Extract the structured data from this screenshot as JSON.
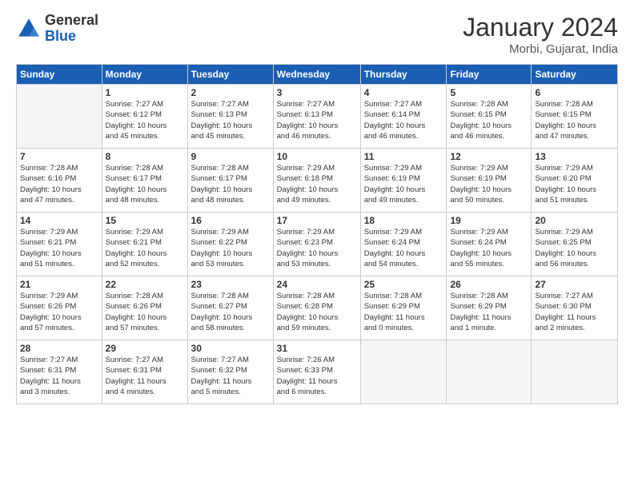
{
  "logo": {
    "general": "General",
    "blue": "Blue"
  },
  "header": {
    "month_year": "January 2024",
    "location": "Morbi, Gujarat, India"
  },
  "weekdays": [
    "Sunday",
    "Monday",
    "Tuesday",
    "Wednesday",
    "Thursday",
    "Friday",
    "Saturday"
  ],
  "weeks": [
    [
      {
        "day": "",
        "info": ""
      },
      {
        "day": "1",
        "info": "Sunrise: 7:27 AM\nSunset: 6:12 PM\nDaylight: 10 hours\nand 45 minutes."
      },
      {
        "day": "2",
        "info": "Sunrise: 7:27 AM\nSunset: 6:13 PM\nDaylight: 10 hours\nand 45 minutes."
      },
      {
        "day": "3",
        "info": "Sunrise: 7:27 AM\nSunset: 6:13 PM\nDaylight: 10 hours\nand 46 minutes."
      },
      {
        "day": "4",
        "info": "Sunrise: 7:27 AM\nSunset: 6:14 PM\nDaylight: 10 hours\nand 46 minutes."
      },
      {
        "day": "5",
        "info": "Sunrise: 7:28 AM\nSunset: 6:15 PM\nDaylight: 10 hours\nand 46 minutes."
      },
      {
        "day": "6",
        "info": "Sunrise: 7:28 AM\nSunset: 6:15 PM\nDaylight: 10 hours\nand 47 minutes."
      }
    ],
    [
      {
        "day": "7",
        "info": "Sunrise: 7:28 AM\nSunset: 6:16 PM\nDaylight: 10 hours\nand 47 minutes."
      },
      {
        "day": "8",
        "info": "Sunrise: 7:28 AM\nSunset: 6:17 PM\nDaylight: 10 hours\nand 48 minutes."
      },
      {
        "day": "9",
        "info": "Sunrise: 7:28 AM\nSunset: 6:17 PM\nDaylight: 10 hours\nand 48 minutes."
      },
      {
        "day": "10",
        "info": "Sunrise: 7:29 AM\nSunset: 6:18 PM\nDaylight: 10 hours\nand 49 minutes."
      },
      {
        "day": "11",
        "info": "Sunrise: 7:29 AM\nSunset: 6:19 PM\nDaylight: 10 hours\nand 49 minutes."
      },
      {
        "day": "12",
        "info": "Sunrise: 7:29 AM\nSunset: 6:19 PM\nDaylight: 10 hours\nand 50 minutes."
      },
      {
        "day": "13",
        "info": "Sunrise: 7:29 AM\nSunset: 6:20 PM\nDaylight: 10 hours\nand 51 minutes."
      }
    ],
    [
      {
        "day": "14",
        "info": "Sunrise: 7:29 AM\nSunset: 6:21 PM\nDaylight: 10 hours\nand 51 minutes."
      },
      {
        "day": "15",
        "info": "Sunrise: 7:29 AM\nSunset: 6:21 PM\nDaylight: 10 hours\nand 52 minutes."
      },
      {
        "day": "16",
        "info": "Sunrise: 7:29 AM\nSunset: 6:22 PM\nDaylight: 10 hours\nand 53 minutes."
      },
      {
        "day": "17",
        "info": "Sunrise: 7:29 AM\nSunset: 6:23 PM\nDaylight: 10 hours\nand 53 minutes."
      },
      {
        "day": "18",
        "info": "Sunrise: 7:29 AM\nSunset: 6:24 PM\nDaylight: 10 hours\nand 54 minutes."
      },
      {
        "day": "19",
        "info": "Sunrise: 7:29 AM\nSunset: 6:24 PM\nDaylight: 10 hours\nand 55 minutes."
      },
      {
        "day": "20",
        "info": "Sunrise: 7:29 AM\nSunset: 6:25 PM\nDaylight: 10 hours\nand 56 minutes."
      }
    ],
    [
      {
        "day": "21",
        "info": "Sunrise: 7:29 AM\nSunset: 6:26 PM\nDaylight: 10 hours\nand 57 minutes."
      },
      {
        "day": "22",
        "info": "Sunrise: 7:28 AM\nSunset: 6:26 PM\nDaylight: 10 hours\nand 57 minutes."
      },
      {
        "day": "23",
        "info": "Sunrise: 7:28 AM\nSunset: 6:27 PM\nDaylight: 10 hours\nand 58 minutes."
      },
      {
        "day": "24",
        "info": "Sunrise: 7:28 AM\nSunset: 6:28 PM\nDaylight: 10 hours\nand 59 minutes."
      },
      {
        "day": "25",
        "info": "Sunrise: 7:28 AM\nSunset: 6:29 PM\nDaylight: 11 hours\nand 0 minutes."
      },
      {
        "day": "26",
        "info": "Sunrise: 7:28 AM\nSunset: 6:29 PM\nDaylight: 11 hours\nand 1 minute."
      },
      {
        "day": "27",
        "info": "Sunrise: 7:27 AM\nSunset: 6:30 PM\nDaylight: 11 hours\nand 2 minutes."
      }
    ],
    [
      {
        "day": "28",
        "info": "Sunrise: 7:27 AM\nSunset: 6:31 PM\nDaylight: 11 hours\nand 3 minutes."
      },
      {
        "day": "29",
        "info": "Sunrise: 7:27 AM\nSunset: 6:31 PM\nDaylight: 11 hours\nand 4 minutes."
      },
      {
        "day": "30",
        "info": "Sunrise: 7:27 AM\nSunset: 6:32 PM\nDaylight: 11 hours\nand 5 minutes."
      },
      {
        "day": "31",
        "info": "Sunrise: 7:26 AM\nSunset: 6:33 PM\nDaylight: 11 hours\nand 6 minutes."
      },
      {
        "day": "",
        "info": ""
      },
      {
        "day": "",
        "info": ""
      },
      {
        "day": "",
        "info": ""
      }
    ]
  ]
}
